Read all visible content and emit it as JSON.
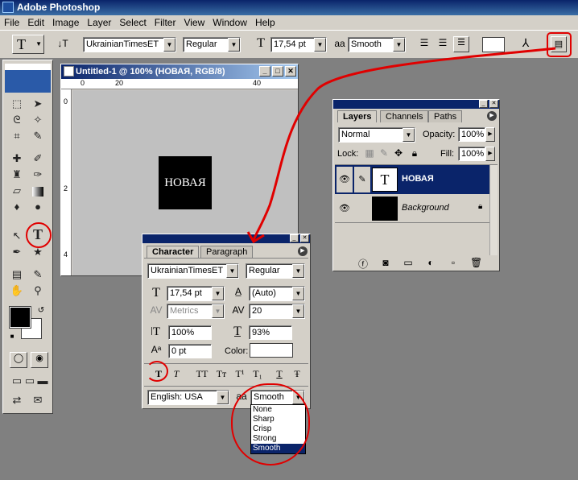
{
  "app": {
    "title": "Adobe Photoshop"
  },
  "menu": [
    "File",
    "Edit",
    "Image",
    "Layer",
    "Select",
    "Filter",
    "View",
    "Window",
    "Help"
  ],
  "options": {
    "tool_glyph": "T",
    "orient_glyph": "↓T",
    "font_family": "UkrainianTimesET",
    "font_style": "Regular",
    "size_glyph": "T",
    "font_size": "17,54 pt",
    "aa_glyph": "aa",
    "antialias": "Smooth"
  },
  "document": {
    "title": "Untitled-1 @ 100% (НОВАЯ, RGB/8)",
    "ruler_h": [
      "0",
      "20",
      "40"
    ],
    "ruler_v": [
      "0",
      "2",
      "4"
    ],
    "canvas_text": "НОВАЯ"
  },
  "layers": {
    "tabs": [
      "Layers",
      "Channels",
      "Paths"
    ],
    "blend": "Normal",
    "opacity_label": "Opacity:",
    "opacity": "100%",
    "lock_label": "Lock:",
    "fill_label": "Fill:",
    "fill": "100%",
    "items": [
      {
        "thumb": "T",
        "name": "НОВАЯ"
      },
      {
        "thumb": "",
        "name": "Background"
      }
    ]
  },
  "character": {
    "tabs": [
      "Character",
      "Paragraph"
    ],
    "font_family": "UkrainianTimesET",
    "font_style": "Regular",
    "font_size": "17,54 pt",
    "leading": "(Auto)",
    "kerning": "Metrics",
    "tracking": "20",
    "vscale": "100%",
    "hscale": "93%",
    "baseline": "0 pt",
    "color_label": "Color:",
    "style_buttons": [
      "T",
      "T",
      "TT",
      "Tт",
      "T¹",
      "T₁",
      "T",
      "Ŧ"
    ],
    "language": "English: USA",
    "aa_glyph": "aa",
    "antialias": "Smooth",
    "antialias_options": [
      "None",
      "Sharp",
      "Crisp",
      "Strong",
      "Smooth"
    ]
  },
  "colors": {
    "accent": "#0a246a",
    "annotation": "#e00000"
  }
}
